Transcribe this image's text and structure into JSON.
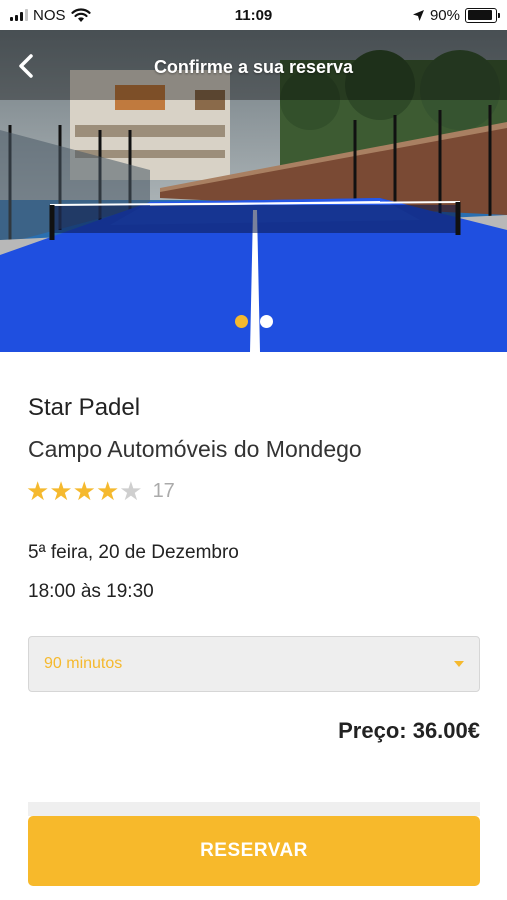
{
  "status_bar": {
    "carrier": "NOS",
    "time": "11:09",
    "battery_percent": "90%",
    "battery_level": 0.9,
    "icons": [
      "signal-icon",
      "wifi-icon",
      "location-arrow-icon",
      "battery-icon"
    ]
  },
  "header": {
    "title": "Confirme a sua reserva",
    "back_icon": "chevron-left-icon"
  },
  "carousel": {
    "slide_count": 2,
    "active_index": 0
  },
  "venue": {
    "club_name": "Star Padel",
    "court_name": "Campo Automóveis do Mondego",
    "rating_stars": 4,
    "rating_max": 5,
    "rating_count": "17"
  },
  "booking": {
    "date": "5ª feira, 20 de Dezembro",
    "time_range": "18:00 às 19:30",
    "duration_selected": "90 minutos",
    "price": "Preço: 36.00€"
  },
  "actions": {
    "reserve_label": "RESERVAR"
  },
  "colors": {
    "accent": "#f5b92e",
    "court_blue": "#1f4fe0",
    "star_empty": "#cfcfcf"
  }
}
